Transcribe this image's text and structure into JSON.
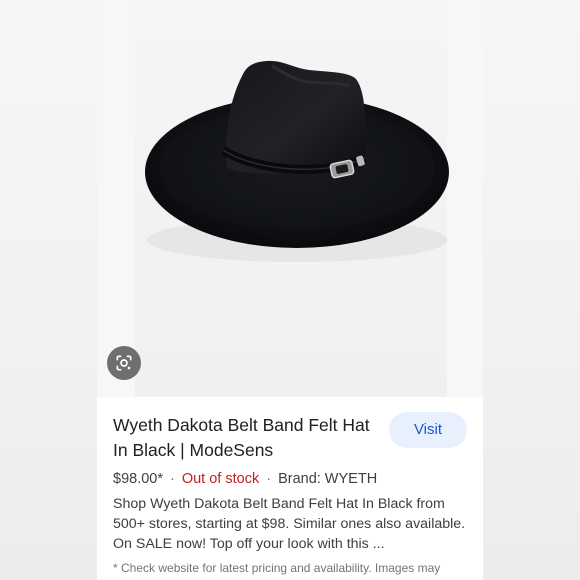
{
  "result": {
    "title": "Wyeth Dakota Belt Band Felt Hat In Black | ModeSens",
    "visit_label": "Visit",
    "price": "$98.00*",
    "stock_status": "Out of stock",
    "brand": "Brand: WYETH",
    "separator": "·",
    "description": "Shop Wyeth Dakota Belt Band Felt Hat In Black from 500+ stores, starting at $98. Similar ones also available. On SALE now! Top off your look with this ...",
    "note": "* Check website for latest pricing and availability. Images may"
  },
  "image": {
    "subject": "black wide-brim felt hat with belt band",
    "lens_icon": "lens-search-icon"
  },
  "colors": {
    "visit_bg": "#e8f0fe",
    "visit_text": "#1a56c9",
    "out_of_stock": "#c5221f",
    "text": "#3c4043"
  }
}
